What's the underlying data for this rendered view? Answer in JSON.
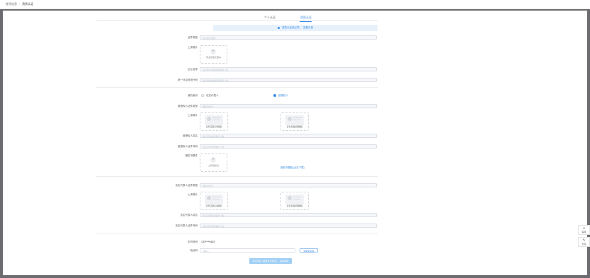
{
  "breadcrumb": {
    "home": "账号信息",
    "current": "资质认证"
  },
  "tabs": [
    {
      "label": "个人认证"
    },
    {
      "label": "资质认证"
    }
  ],
  "notice": {
    "text": "资质认证前必须，",
    "link": "查看示例"
  },
  "enterprise": {
    "cert_type_label": "证件类型",
    "cert_type_placeholder": "企业营业执照",
    "upload_label": "上传照片",
    "upload_caption": "营业执照正副本",
    "name_label": "企业名称",
    "name_placeholder": "请与营业执照名称保持一致",
    "code_label": "统一社会信用代码",
    "code_placeholder": "请与营业执照代码保持一致"
  },
  "applicant": {
    "label": "我的身份",
    "option_legal": "法定代表人",
    "option_agent": "被授权人",
    "selected": "被授权人"
  },
  "agent": {
    "cert_type_label": "被授权人证件类型",
    "cert_type_placeholder": "居民身份证",
    "photo_label": "上传照片",
    "front_caption": "证件正面(头像面)",
    "back_caption": "证件反面(国徽面)",
    "name_label": "被授权人姓名",
    "name_placeholder": "请与证件姓名保持一致",
    "id_label": "被授权人证件号码",
    "id_placeholder": "请与证件号码保持一致",
    "letter_label": "授权书原件",
    "letter_caption": "上传授权书",
    "letter_link": "授权书模板(点击下载)"
  },
  "legal": {
    "cert_type_label": "法定代表人证件类型",
    "cert_type_placeholder": "居民身份证",
    "photo_label": "上传照片",
    "front_caption": "证件正面(头像面)",
    "back_caption": "证件反面(国徽面)",
    "name_label": "法定代表人姓名",
    "name_placeholder": "请与证件姓名保持一致",
    "id_label": "法定代表人证件号码",
    "id_placeholder": "请与证件号码保持一致"
  },
  "verify": {
    "phone_label": "手机号码",
    "phone_value": "133****9463",
    "code_label": "验证码",
    "code_placeholder": "请输入",
    "code_button": "获取验证码",
    "submit": "我已阅读《资质认证协议》，提交审核"
  },
  "floating": [
    {
      "icon": "☺",
      "label": "客服"
    },
    {
      "icon": "✎",
      "label": "反馈"
    }
  ],
  "colors": {
    "accent": "#3a8ee6",
    "notice_bg": "#e6f1fc",
    "submit_bg": "#a0cff5"
  }
}
